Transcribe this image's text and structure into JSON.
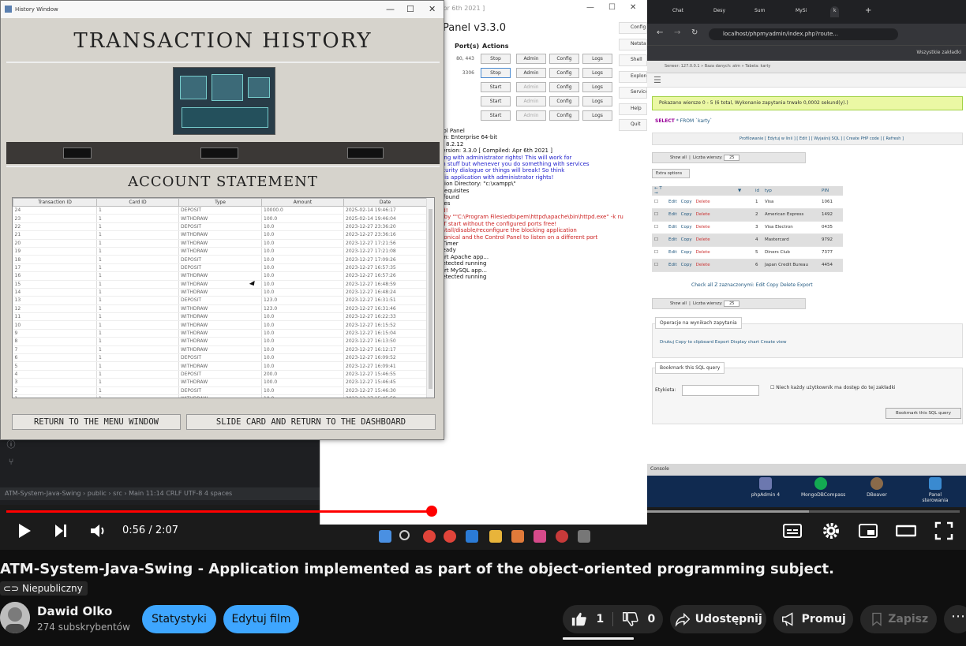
{
  "history_window": {
    "window_title": "History Window",
    "title": "TRANSACTION HISTORY",
    "subtitle": "ACCOUNT STATEMENT",
    "columns": [
      "Transaction ID",
      "Card ID",
      "Type",
      "Amount",
      "Date"
    ],
    "rows": [
      [
        "24",
        "1",
        "DEPOSIT",
        "10000.0",
        "2025-02-14 19:46:17"
      ],
      [
        "23",
        "1",
        "WITHDRAW",
        "100.0",
        "2025-02-14 19:46:04"
      ],
      [
        "22",
        "1",
        "DEPOSIT",
        "10.0",
        "2023-12-27 23:36:20"
      ],
      [
        "21",
        "1",
        "WITHDRAW",
        "10.0",
        "2023-12-27 23:36:16"
      ],
      [
        "20",
        "1",
        "WITHDRAW",
        "10.0",
        "2023-12-27 17:21:56"
      ],
      [
        "19",
        "1",
        "WITHDRAW",
        "10.0",
        "2023-12-27 17:21:08"
      ],
      [
        "18",
        "1",
        "DEPOSIT",
        "10.0",
        "2023-12-27 17:09:26"
      ],
      [
        "17",
        "1",
        "DEPOSIT",
        "10.0",
        "2023-12-27 16:57:35"
      ],
      [
        "16",
        "1",
        "WITHDRAW",
        "10.0",
        "2023-12-27 16:57:26"
      ],
      [
        "15",
        "1",
        "WITHDRAW",
        "10.0",
        "2023-12-27 16:48:59"
      ],
      [
        "14",
        "1",
        "WITHDRAW",
        "10.0",
        "2023-12-27 16:48:24"
      ],
      [
        "13",
        "1",
        "DEPOSIT",
        "123.0",
        "2023-12-27 16:31:51"
      ],
      [
        "12",
        "1",
        "WITHDRAW",
        "123.0",
        "2023-12-27 16:31:46"
      ],
      [
        "11",
        "1",
        "WITHDRAW",
        "10.0",
        "2023-12-27 16:22:33"
      ],
      [
        "10",
        "1",
        "WITHDRAW",
        "10.0",
        "2023-12-27 16:15:52"
      ],
      [
        "9",
        "1",
        "WITHDRAW",
        "10.0",
        "2023-12-27 16:15:04"
      ],
      [
        "8",
        "1",
        "WITHDRAW",
        "10.0",
        "2023-12-27 16:13:50"
      ],
      [
        "7",
        "1",
        "WITHDRAW",
        "10.0",
        "2023-12-27 16:12:17"
      ],
      [
        "6",
        "1",
        "DEPOSIT",
        "10.0",
        "2023-12-27 16:09:52"
      ],
      [
        "5",
        "1",
        "WITHDRAW",
        "10.0",
        "2023-12-27 16:09:41"
      ],
      [
        "4",
        "1",
        "DEPOSIT",
        "200.0",
        "2023-12-27 15:46:55"
      ],
      [
        "3",
        "1",
        "WITHDRAW",
        "100.0",
        "2023-12-27 15:46:45"
      ],
      [
        "2",
        "1",
        "DEPOSIT",
        "10.0",
        "2023-12-27 15:46:30"
      ],
      [
        "1",
        "1",
        "WITHDRAW",
        "10.0",
        "2023-12-27 15:45:58"
      ]
    ],
    "btn_return_menu": "RETURN TO THE MENU WINDOW",
    "btn_slide_card": "SLIDE CARD AND RETURN TO THE DASHBOARD"
  },
  "xampp": {
    "title": "Apr 6th 2021 ]",
    "header": "Panel v3.3.0",
    "col_ports": "Port(s)",
    "col_actions": "Actions",
    "rows": [
      {
        "ports": "80, 443",
        "action": "Stop"
      },
      {
        "ports": "3306",
        "action": "Stop"
      },
      {
        "ports": "",
        "action": "Start"
      },
      {
        "ports": "",
        "action": "Start"
      },
      {
        "ports": "",
        "action": "Start"
      }
    ],
    "admin_label": "Admin",
    "config_label": "Config",
    "logs_label": "Logs",
    "side_buttons": [
      "Config",
      "Netstat",
      "Shell",
      "Explorer",
      "Services",
      "Help",
      "Quit"
    ],
    "log": [
      {
        "t": "trol Panel",
        "c": "k"
      },
      {
        "t": "ion: Enterprise 64-bit",
        "c": "k"
      },
      {
        "t": "n: 8.2.12",
        "c": "k"
      },
      {
        "t": "Version: 3.3.0 [ Compiled: Apr 6th 2021 ]",
        "c": "k"
      },
      {
        "t": "ning with administrator rights! This will work for",
        "c": "b"
      },
      {
        "t": "on stuff but whenever you do something with services",
        "c": "b"
      },
      {
        "t": "ecurity dialogue or things will break! So think",
        "c": "b"
      },
      {
        "t": "this application with administrator rights!",
        "c": "b"
      },
      {
        "t": "ation Directory: \"c:\\xampp\\\"",
        "c": "k"
      },
      {
        "t": "erequisites",
        "c": "k"
      },
      {
        "t": "s found",
        "c": "k"
      },
      {
        "t": "ules",
        "c": "k"
      },
      {
        "t": "ed!",
        "c": "r"
      },
      {
        "t": "d by \"\"C:\\Program Files\\edb\\pem\\httpd\\apache\\bin\\httpd.exe\" -k ru",
        "c": "r"
      },
      {
        "t": "OT start without the configured ports free!",
        "c": "r"
      },
      {
        "t": "nstall/disable/reconfigure the blocking application",
        "c": "r"
      },
      {
        "t": "fconical and the Control Panel to listen on a different port",
        "c": "r"
      },
      {
        "t": "t-Timer",
        "c": "k"
      },
      {
        "t": "Ready",
        "c": "k"
      },
      {
        "t": "tart Apache app...",
        "c": "k"
      },
      {
        "t": "detected running",
        "c": "k"
      },
      {
        "t": "tart MySQL app...",
        "c": "k"
      },
      {
        "t": "detected running",
        "c": "k"
      }
    ]
  },
  "chrome": {
    "tabs": [
      "Chat",
      "Desy",
      "Sum",
      "MySi",
      "k"
    ],
    "url": "localhost/phpmyadmin/index.php?route...",
    "bookmarks_label": "Wszystkie zakładki",
    "pma_breadcrumb": "Serwer: 127.0.0.1 » Baza danych: atm » Tabela: karty",
    "success_msg": "Pokazano wiersze 0 - 5 (6 total, Wykonanie zapytania trwało 0,0002 sekund(y).)",
    "sql_select": "SELECT",
    "sql_rest": "* FROM `karty`",
    "options_links": "Profilowanie [ Edytuj w linii ] [ Edit ] [ Wyjaśnij SQL ] [ Create PHP code ] [ Refresh ]",
    "show_all": "Show all",
    "rows_label": "Liczba wierszy:",
    "rows_value": "25",
    "extra_options": "Extra options",
    "table_headers": [
      "",
      "",
      "",
      "id",
      "typ",
      "PIN"
    ],
    "table_rows": [
      {
        "id": "1",
        "typ": "Visa",
        "pin": "1061"
      },
      {
        "id": "2",
        "typ": "American Express",
        "pin": "1492"
      },
      {
        "id": "3",
        "typ": "Visa Electron",
        "pin": "0435"
      },
      {
        "id": "4",
        "typ": "Mastercard",
        "pin": "9792"
      },
      {
        "id": "5",
        "typ": "Diners Club",
        "pin": "7377"
      },
      {
        "id": "6",
        "typ": "Japan Credit Bureau",
        "pin": "4454"
      }
    ],
    "edit_label": "Edit",
    "copy_label": "Copy",
    "delete_label": "Delete",
    "bulk_actions": "Check all    Z zaznaczonymi:   Edit   Copy   Delete   Export",
    "ops_legend": "Operacje na wynikach zapytania",
    "ops_links": "Drukuj    Copy to clipboard    Export    Display chart    Create view",
    "bookmark_legend": "Bookmark this SQL query",
    "label_etykieta": "Etykieta:",
    "label_shared": "Niech każdy użytkownik ma dostęp do tej zakładki",
    "bookmark_submit": "Bookmark this SQL query",
    "console": "Console"
  },
  "desktop_icons": [
    "phpAdmin 4",
    "MongoDBCompass",
    "DBeaver",
    "Panel sterowania"
  ],
  "editor_status": "ATM-System-Java-Swing › public › src › Main     11:14   CRLF   UTF-8   4 spaces",
  "player": {
    "current_time": "0:56",
    "duration": "2:07",
    "time_separator": " / ",
    "progress_fraction": 0.446,
    "buffered_fraction": 0.842
  },
  "video": {
    "title": "ATM-System-Java-Swing - Application implemented as part of the object-oriented programming subject.",
    "visibility": "Niepubliczny",
    "channel_name": "Dawid Olko",
    "subscribers": "274 subskrybentów",
    "btn_stats": "Statystyki",
    "btn_edit": "Edytuj film",
    "likes": "1",
    "dislikes": "0",
    "btn_share": "Udostępnij",
    "btn_promote": "Promuj",
    "btn_save": "Zapisz"
  },
  "colors": {
    "accent": "#ff0000",
    "blue_button": "#3ea6ff",
    "pill_bg": "#272727"
  }
}
